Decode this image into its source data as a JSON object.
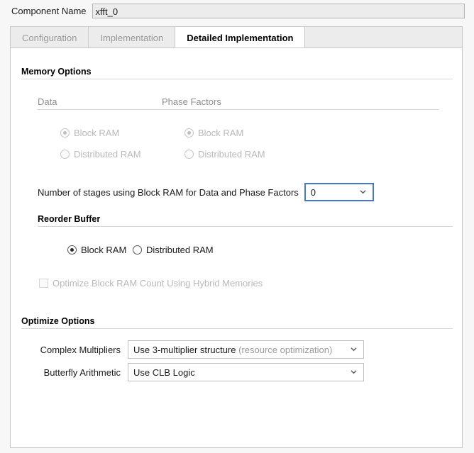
{
  "component": {
    "label": "Component Name",
    "value": "xfft_0"
  },
  "tabs": [
    {
      "label": "Configuration",
      "active": false
    },
    {
      "label": "Implementation",
      "active": false
    },
    {
      "label": "Detailed Implementation",
      "active": true
    }
  ],
  "memory_options": {
    "title": "Memory Options",
    "data": {
      "title": "Data",
      "options": [
        {
          "label": "Block RAM",
          "selected": true,
          "disabled": true
        },
        {
          "label": "Distributed RAM",
          "selected": false,
          "disabled": true
        }
      ]
    },
    "phase_factors": {
      "title": "Phase Factors",
      "options": [
        {
          "label": "Block RAM",
          "selected": true,
          "disabled": true
        },
        {
          "label": "Distributed RAM",
          "selected": false,
          "disabled": true
        }
      ]
    },
    "stages": {
      "label": "Number of stages using Block RAM for Data and Phase Factors",
      "value": "0",
      "focused": true
    }
  },
  "reorder_buffer": {
    "title": "Reorder Buffer",
    "options": [
      {
        "label": "Block RAM",
        "selected": true,
        "disabled": false
      },
      {
        "label": "Distributed RAM",
        "selected": false,
        "disabled": false
      }
    ],
    "optimize_checkbox": {
      "label": "Optimize Block RAM Count Using Hybrid Memories",
      "checked": false,
      "disabled": true
    }
  },
  "optimize_options": {
    "title": "Optimize Options",
    "complex_multipliers": {
      "label": "Complex Multipliers",
      "value_main": "Use 3-multiplier structure",
      "value_muted": "(resource optimization)"
    },
    "butterfly_arithmetic": {
      "label": "Butterfly Arithmetic",
      "value_main": "Use CLB Logic",
      "value_muted": ""
    }
  },
  "icons": {
    "chevron_down": "chevron-down-icon"
  },
  "colors": {
    "focus_blue": "#4a7ab5",
    "panel_bg": "#ffffff",
    "page_bg": "#f7f7f7",
    "rule": "#d6d6d6",
    "disabled_text": "#b9b9b9"
  }
}
